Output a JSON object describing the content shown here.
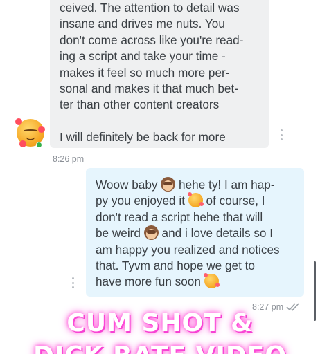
{
  "thread": {
    "inbound": {
      "text": "ceived. The attention to detail was\ninsane and drives me nuts. You\ndon't come across like you're read-\ning a script and take your time -\nmakes it feel so much more per-\nsonal and makes it that much bet-\nter than other content creators",
      "last_line": "I will definitely be back for more",
      "time": "8:26 pm",
      "avatar_icon": "smiling-face-with-hearts-icon"
    },
    "outbound": {
      "segments": [
        "Woow baby ",
        " hehe ty! I am hap-\npy you enjoyed it ",
        " of course, I\ndon't read a script hehe that will\nbe weird ",
        " and i love details so I\nam happy you realized and notices\nthat. Tyvm and hope we get to\nhave more fun soon "
      ],
      "emojis": [
        "see-no-evil-monkey-icon",
        "smiling-face-with-hearts-icon",
        "see-no-evil-monkey-icon",
        "smiling-face-with-hearts-icon"
      ],
      "time": "8:27 pm",
      "read_status_icon": "double-check-icon"
    }
  },
  "overlay": {
    "title": "CUM SHOT &",
    "subtitle": "DICK RATE VIDEO"
  },
  "colors": {
    "inbound_bubble": "#eff0f1",
    "outbound_bubble": "#e6f5fd",
    "overlay_glow": "#ff4fd8"
  }
}
